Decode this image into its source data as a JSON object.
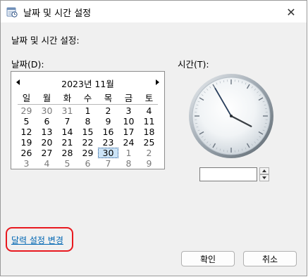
{
  "window": {
    "title": "날짜 및 시간 설정",
    "close_glyph": "✕"
  },
  "heading": "날짜 및 시간 설정:",
  "date_label": "날짜(D):",
  "time_label": "시간(T):",
  "calendar": {
    "month_title": "2023년 11월",
    "weekdays": [
      "일",
      "월",
      "화",
      "수",
      "목",
      "금",
      "토"
    ],
    "weeks": [
      [
        {
          "d": "29",
          "other": true
        },
        {
          "d": "30",
          "other": true
        },
        {
          "d": "31",
          "other": true
        },
        {
          "d": "1"
        },
        {
          "d": "2"
        },
        {
          "d": "3"
        },
        {
          "d": "4"
        }
      ],
      [
        {
          "d": "5"
        },
        {
          "d": "6"
        },
        {
          "d": "7"
        },
        {
          "d": "8"
        },
        {
          "d": "9"
        },
        {
          "d": "10"
        },
        {
          "d": "11"
        }
      ],
      [
        {
          "d": "12"
        },
        {
          "d": "13"
        },
        {
          "d": "14"
        },
        {
          "d": "15"
        },
        {
          "d": "16"
        },
        {
          "d": "17"
        },
        {
          "d": "18"
        }
      ],
      [
        {
          "d": "19"
        },
        {
          "d": "20"
        },
        {
          "d": "21"
        },
        {
          "d": "22"
        },
        {
          "d": "23"
        },
        {
          "d": "24"
        },
        {
          "d": "25"
        }
      ],
      [
        {
          "d": "26"
        },
        {
          "d": "27"
        },
        {
          "d": "28"
        },
        {
          "d": "29"
        },
        {
          "d": "30",
          "selected": true
        },
        {
          "d": "1",
          "other": true
        },
        {
          "d": "2",
          "other": true
        }
      ],
      [
        {
          "d": "3",
          "other": true
        },
        {
          "d": "4",
          "other": true
        },
        {
          "d": "5",
          "other": true
        },
        {
          "d": "6",
          "other": true
        },
        {
          "d": "7",
          "other": true
        },
        {
          "d": "8",
          "other": true
        },
        {
          "d": "9",
          "other": true
        }
      ]
    ]
  },
  "clock": {
    "hour": 3,
    "minute": 55,
    "second": 55
  },
  "time_value": "",
  "calendar_settings_link": "달력 설정 변경",
  "buttons": {
    "ok": "확인",
    "cancel": "취소"
  },
  "colors": {
    "link": "#0066b3",
    "highlight": "#e8191f",
    "selected_day": "#cce4f7",
    "second_hand": "#1f3f6e"
  },
  "icons": {
    "app": "clock-calendar-icon",
    "close": "close-icon",
    "prev": "chevron-left-icon",
    "next": "chevron-right-icon",
    "spin_up": "caret-up-icon",
    "spin_down": "caret-down-icon"
  }
}
